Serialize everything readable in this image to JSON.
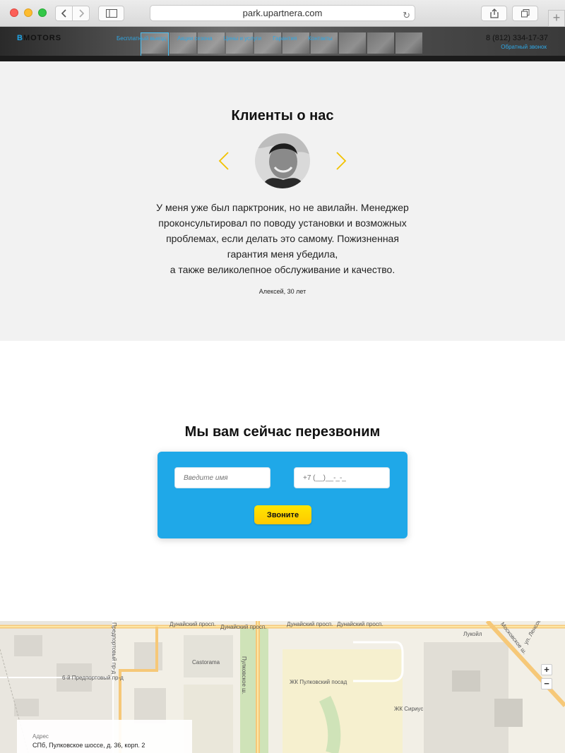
{
  "browser": {
    "url": "park.upartnera.com"
  },
  "header": {
    "logo_mark": "B",
    "logo_text": "MOTORS",
    "menu": [
      "Бесплатный выезд",
      "Акции сезона",
      "Цены и услуги",
      "Гарантия",
      "Контакты"
    ],
    "phone": "8 (812) 334-17-37",
    "callback_link": "Обратный звонок"
  },
  "testimonials": {
    "title": "Клиенты о нас",
    "quote_lines": [
      "У меня уже был парктроник, но не авилайн. Менеджер",
      "проконсультировал по поводу установки и возможных",
      "проблемах, если делать это самому. Пожизненная",
      "гарантия меня убедила,",
      "а также великолепное обслуживание и качество."
    ],
    "author": "Алексей, 30 лет",
    "arrow_color": "#f2c200"
  },
  "callback": {
    "title": "Мы вам сейчас перезвоним",
    "name_placeholder": "Введите имя",
    "phone_placeholder": "+7 (__)__-_-_",
    "button_label": "Звоните",
    "form_color": "#1fa8e8",
    "button_color": "#ffd400"
  },
  "map": {
    "labels": {
      "street1": "Дунайский просп.",
      "street2": "Дунайский просп.",
      "street3": "Дунайский просп.",
      "street4": "Пулковское ш.",
      "street5": "6-й Предпортовый пр-д",
      "street6": "Предпортовый пр-д",
      "street7": "Московское ш.",
      "castorama": "Castorama",
      "pulkovo": "ЖК Пулковский посад",
      "sirius": "ЖК Сириус",
      "lukoil": "Лукойл",
      "lenkovet": "ул. Ленсовета"
    },
    "zoom_in": "+",
    "zoom_out": "−",
    "address_label": "Адрес",
    "address": "СПб, Пулковское шоссе, д. 36, корп. 2"
  }
}
